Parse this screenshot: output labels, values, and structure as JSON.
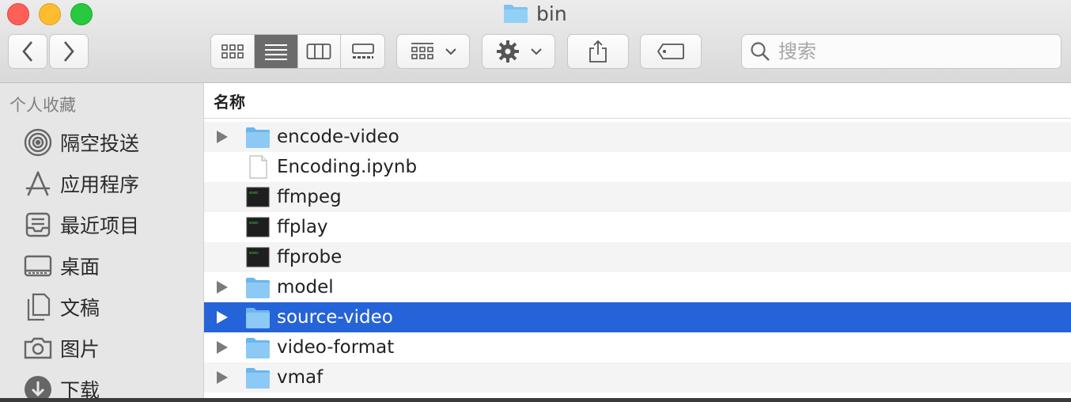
{
  "window": {
    "title": "bin"
  },
  "toolbar": {
    "back_icon": "chevron-left-icon",
    "forward_icon": "chevron-right-icon",
    "view_modes": [
      "icon-view",
      "list-view",
      "column-view",
      "gallery-view"
    ],
    "active_view": "list-view",
    "group_icon": "group-grid-icon",
    "action_icon": "gear-icon",
    "share_icon": "share-icon",
    "tag_icon": "tag-icon"
  },
  "search": {
    "placeholder": "搜索",
    "value": ""
  },
  "sidebar": {
    "header": "个人收藏",
    "items": [
      {
        "label": "隔空投送",
        "icon": "airdrop-icon"
      },
      {
        "label": "应用程序",
        "icon": "applications-icon"
      },
      {
        "label": "最近项目",
        "icon": "recents-icon"
      },
      {
        "label": "桌面",
        "icon": "desktop-icon"
      },
      {
        "label": "文稿",
        "icon": "documents-icon"
      },
      {
        "label": "图片",
        "icon": "pictures-icon"
      },
      {
        "label": "下载",
        "icon": "downloads-icon"
      }
    ]
  },
  "file_list": {
    "column_header": "名称",
    "items": [
      {
        "name": "encode-video",
        "kind": "folder"
      },
      {
        "name": "Encoding.ipynb",
        "kind": "document"
      },
      {
        "name": "ffmpeg",
        "kind": "executable"
      },
      {
        "name": "ffplay",
        "kind": "executable"
      },
      {
        "name": "ffprobe",
        "kind": "executable"
      },
      {
        "name": "model",
        "kind": "folder"
      },
      {
        "name": "source-video",
        "kind": "folder",
        "selected": true
      },
      {
        "name": "video-format",
        "kind": "folder"
      },
      {
        "name": "vmaf",
        "kind": "folder"
      }
    ]
  },
  "colors": {
    "selection": "#2563d8",
    "folder": "#7cc2f2"
  }
}
